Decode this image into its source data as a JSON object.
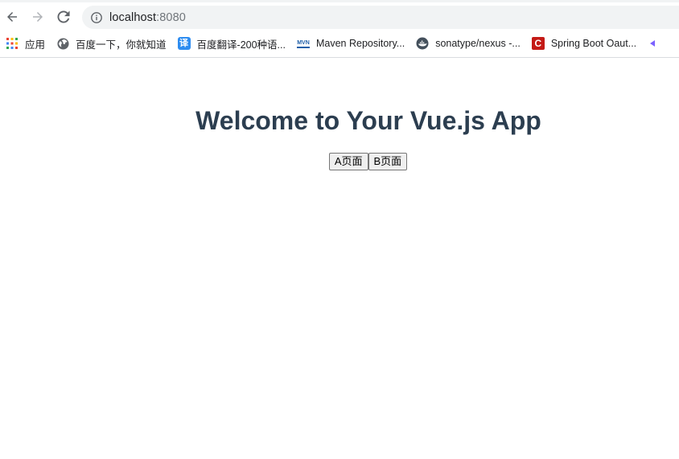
{
  "browser": {
    "url_host": "localhost",
    "url_port": ":8080",
    "bookmarks": [
      {
        "label": "应用",
        "icon": "apps-grid-icon"
      },
      {
        "label": "百度一下，你就知道",
        "icon": "globe-icon"
      },
      {
        "label": "百度翻译-200种语...",
        "icon": "translate-icon"
      },
      {
        "label": "Maven Repository...",
        "icon": "mvn-icon"
      },
      {
        "label": "sonatype/nexus -...",
        "icon": "docker-icon"
      },
      {
        "label": "Spring Boot Oaut...",
        "icon": "c-red-icon"
      }
    ],
    "translate_glyph": "译",
    "mvn_glyph": "MVN",
    "c_glyph": "C"
  },
  "app": {
    "title": "Welcome to Your Vue.js App",
    "buttons": [
      {
        "label": "A页面"
      },
      {
        "label": "B页面"
      }
    ]
  }
}
